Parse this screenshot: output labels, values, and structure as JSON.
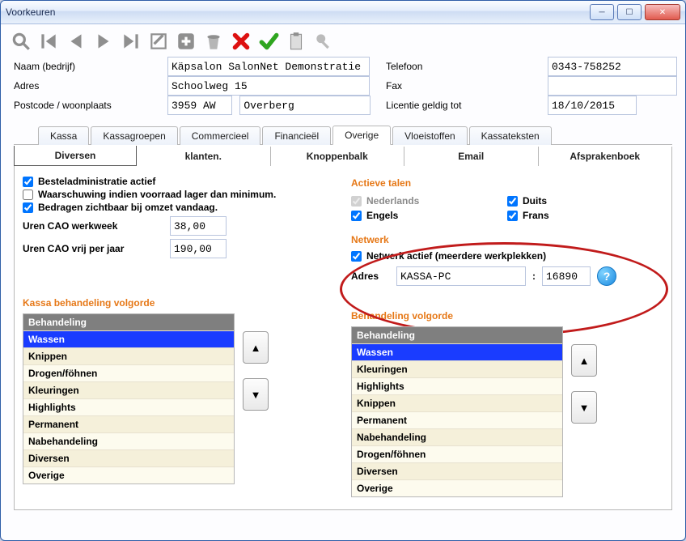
{
  "window": {
    "title": "Voorkeuren"
  },
  "toolbar": {
    "icons": [
      "search",
      "first",
      "prev",
      "next",
      "last",
      "edit",
      "new",
      "delete",
      "cancel",
      "confirm",
      "clipboard",
      "lock"
    ]
  },
  "company": {
    "name_label": "Naam (bedrijf)",
    "name_value": "Käpsalon SalonNet Demonstratie",
    "addr_label": "Adres",
    "addr_value": "Schoolweg 15",
    "postal_label": "Postcode / woonplaats",
    "postal_value": "3959 AW",
    "city_value": "Overberg",
    "phone_label": "Telefoon",
    "phone_value": "0343-758252",
    "fax_label": "Fax",
    "fax_value": "",
    "licence_label": "Licentie geldig tot",
    "licence_value": "18/10/2015"
  },
  "tabs_main": {
    "kassa": "Kassa",
    "kassagroepen": "Kassagroepen",
    "commercieel": "Commercieel",
    "financieel": "Financieël",
    "overige": "Overige",
    "vloeistoffen": "Vloeistoffen",
    "kassateksten": "Kassateksten"
  },
  "tabs_sub": {
    "diversen": "Diversen",
    "klanten": "klanten.",
    "knoppenbalk": "Knoppenbalk",
    "email": "Email",
    "afsprakenboek": "Afsprakenboek"
  },
  "left": {
    "bestel": "Besteladministratie actief",
    "waarschuwing": "Waarschuwing indien voorraad lager dan minimum.",
    "bedragen": "Bedragen zichtbaar bij omzet vandaag.",
    "uren_week_label": "Uren CAO werkweek",
    "uren_week_value": "38,00",
    "uren_jaar_label": "Uren CAO vrij per jaar",
    "uren_jaar_value": "190,00"
  },
  "langs": {
    "title": "Actieve talen",
    "nl": "Nederlands",
    "en": "Engels",
    "de": "Duits",
    "fr": "Frans"
  },
  "net": {
    "title": "Netwerk",
    "active": "Netwerk actief (meerdere werkplekken)",
    "addr_label": "Adres",
    "addr_value": "KASSA-PC",
    "sep": ":",
    "port": "16890"
  },
  "listA": {
    "title": "Kassa behandeling volgorde",
    "header": "Behandeling",
    "items": [
      "Wassen",
      "Knippen",
      "Drogen/föhnen",
      "Kleuringen",
      "Highlights",
      "Permanent",
      "Nabehandeling",
      "Diversen",
      "Overige"
    ]
  },
  "listB": {
    "title": "Behandeling volgorde",
    "header": "Behandeling",
    "items": [
      "Wassen",
      "Kleuringen",
      "Highlights",
      "Knippen",
      "Permanent",
      "Nabehandeling",
      "Drogen/föhnen",
      "Diversen",
      "Overige"
    ]
  }
}
